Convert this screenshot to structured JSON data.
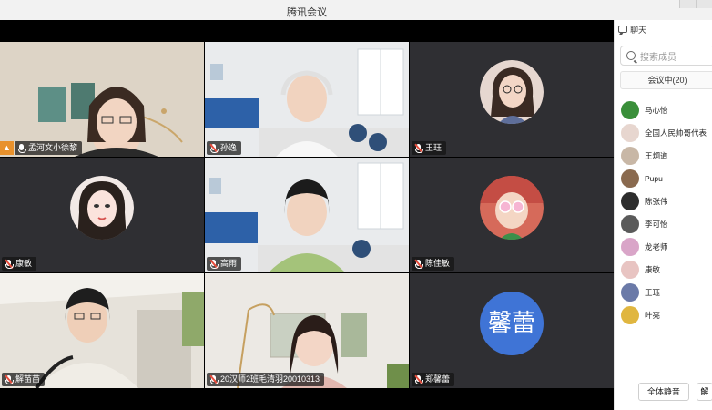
{
  "window": {
    "title": "腾讯会议"
  },
  "tiles": [
    {
      "name": "孟河文小徐黎",
      "muted": false,
      "host": true
    },
    {
      "name": "孙逸",
      "muted": true
    },
    {
      "name": "王珏",
      "muted": true
    },
    {
      "name": "康敏",
      "muted": true
    },
    {
      "name": "高雨",
      "muted": true
    },
    {
      "name": "陈佳敏",
      "muted": true
    },
    {
      "name": "解苗苗",
      "muted": true
    },
    {
      "name": "20汉师2班毛清羽20010313",
      "muted": true
    },
    {
      "name": "郑馨蕾",
      "muted": true,
      "avatar_text": "馨蕾"
    }
  ],
  "sidebar": {
    "chat_label": "聊天",
    "search_placeholder": "搜索成员",
    "tab_label": "会议中(20)",
    "members": [
      {
        "name": "马心怡",
        "color": "#3a8f3a"
      },
      {
        "name": "全国人民帅哥代表",
        "color": "#e7d6cf"
      },
      {
        "name": "王炯道",
        "color": "#c8b7a6"
      },
      {
        "name": "Pupu",
        "color": "#8a6a4f"
      },
      {
        "name": "陈张伟",
        "color": "#2d2d2d"
      },
      {
        "name": "李可怡",
        "color": "#5a5a5a"
      },
      {
        "name": "龙老师",
        "color": "#d9a5c8"
      },
      {
        "name": "康敏",
        "color": "#e8c4c2"
      },
      {
        "name": "王珏",
        "color": "#6b7aa8"
      },
      {
        "name": "叶亮",
        "color": "#e0b640"
      }
    ],
    "mute_all_label": "全体静音",
    "more_label": "解"
  }
}
